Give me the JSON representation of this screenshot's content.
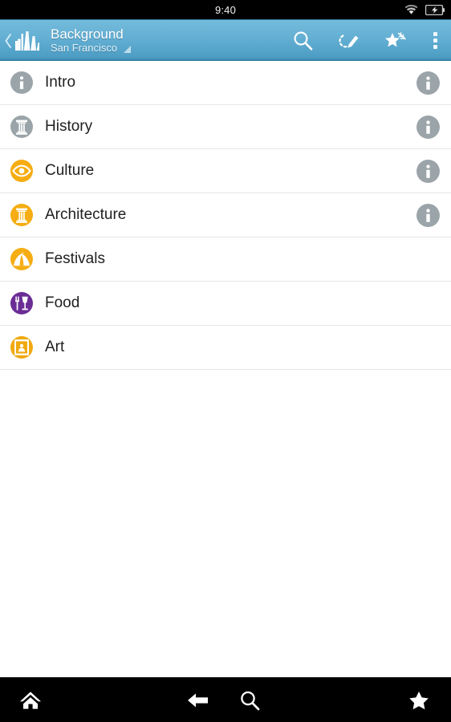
{
  "status_bar": {
    "clock": "9:40",
    "wifi_icon": "wifi-icon",
    "battery_icon": "battery-charging-icon"
  },
  "app_bar": {
    "up_icon": "back-chevron-icon",
    "logo_icon": "app-waveform-logo-icon",
    "title": "Background",
    "subtitle": "San Francisco",
    "subtitle_dropdown_icon": "dropdown-triangle-icon",
    "accent_color": "#63afd3",
    "actions": [
      {
        "name": "search-button",
        "icon": "search-icon",
        "label": "Search"
      },
      {
        "name": "edit-button",
        "icon": "pencil-edit-icon",
        "label": "Edit"
      },
      {
        "name": "favorite-button",
        "icon": "star-sparkle-icon",
        "label": "Favorites"
      },
      {
        "name": "overflow-menu-button",
        "icon": "overflow-dots-icon",
        "label": "More options"
      }
    ]
  },
  "list": {
    "items": [
      {
        "label": "Intro",
        "icon": "info-icon",
        "badge_color": "#9aa4a9",
        "has_info": true
      },
      {
        "label": "History",
        "icon": "pillar-icon",
        "badge_color": "#9aa4a9",
        "has_info": true
      },
      {
        "label": "Culture",
        "icon": "eye-icon",
        "badge_color": "#f5ad13",
        "has_info": true
      },
      {
        "label": "Architecture",
        "icon": "pillar-icon",
        "badge_color": "#f5ad13",
        "has_info": true
      },
      {
        "label": "Festivals",
        "icon": "tent-icon",
        "badge_color": "#f5ad13",
        "has_info": false
      },
      {
        "label": "Food",
        "icon": "food-icon",
        "badge_color": "#6b2d95",
        "has_info": false
      },
      {
        "label": "Art",
        "icon": "artframe-icon",
        "badge_color": "#f0a90f",
        "has_info": false
      }
    ],
    "info_badge_color": "#9aa4a9"
  },
  "nav_bar": {
    "buttons": [
      {
        "name": "nav-home-button",
        "icon": "home-icon",
        "label": "Home"
      },
      {
        "name": "nav-back-button",
        "icon": "back-arrow-icon",
        "label": "Back"
      },
      {
        "name": "nav-search-button",
        "icon": "search-icon",
        "label": "Search"
      },
      {
        "name": "nav-star-button",
        "icon": "star-icon",
        "label": "Favorites"
      }
    ]
  }
}
